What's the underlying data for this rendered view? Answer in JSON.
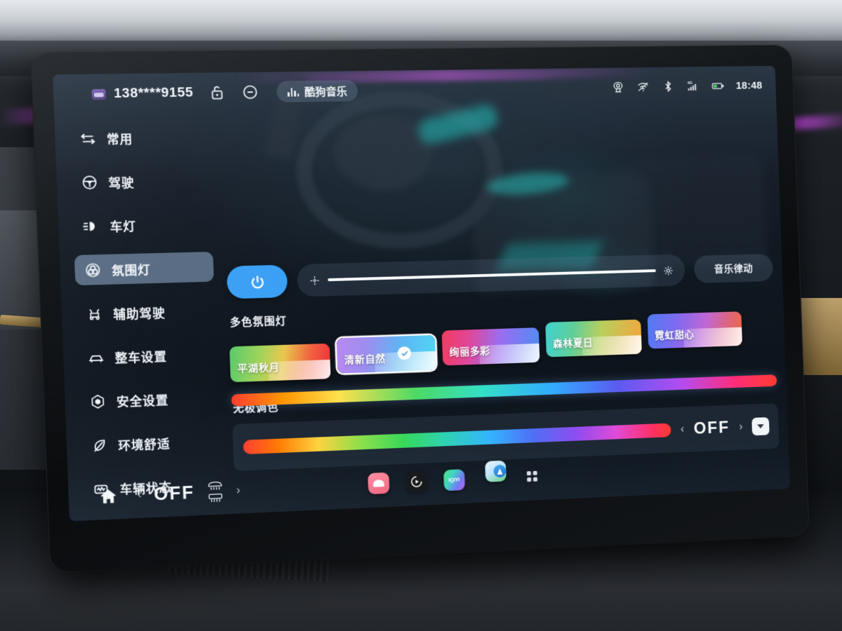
{
  "status_bar": {
    "account_number": "138****9155",
    "lock_icon": "unlock-icon",
    "mute_icon": "minus-circle-icon",
    "music_app_label": "酷狗音乐",
    "music_icon": "equalizer-bars-icon",
    "right_icons": [
      "camera-icon",
      "wifi-off-icon",
      "bluetooth-icon",
      "cellular-4g-icon",
      "battery-icon"
    ],
    "network_label": "4G",
    "time": "18:48"
  },
  "sidebar": {
    "items": [
      {
        "label": "常用",
        "icon": "sliders-icon",
        "selected": false
      },
      {
        "label": "驾驶",
        "icon": "steering-wheel-icon",
        "selected": false
      },
      {
        "label": "车灯",
        "icon": "headlight-icon",
        "selected": false
      },
      {
        "label": "氛围灯",
        "icon": "ambient-light-icon",
        "selected": true
      },
      {
        "label": "辅助驾驶",
        "icon": "adas-icon",
        "selected": false
      },
      {
        "label": "整车设置",
        "icon": "car-icon",
        "selected": false
      },
      {
        "label": "安全设置",
        "icon": "cube-shield-icon",
        "selected": false
      },
      {
        "label": "环境舒适",
        "icon": "leaf-icon",
        "selected": false
      },
      {
        "label": "车辆状态",
        "icon": "vehicle-status-icon",
        "selected": false
      }
    ]
  },
  "main": {
    "power_button": {
      "icon": "power-icon",
      "state": "on",
      "accent_color": "#3aa0f5"
    },
    "brightness": {
      "left_icon": "low-brightness-icon",
      "right_icon": "high-brightness-icon",
      "value_percent": 100
    },
    "music_rhythm_label": "音乐律动",
    "multicolor_section_title": "多色氛围灯",
    "presets": [
      {
        "name": "平湖秋月",
        "gradient": "linear-gradient(100deg,#57c96b 0%,#9bd45c 28%,#e8c84e 52%,#f0613f 78%,#ef2f3c 100%)",
        "selected": false
      },
      {
        "name": "清新自然",
        "gradient": "linear-gradient(100deg,#b989ef 0%,#9d8df0 30%,#5fb5f2 62%,#4fd7f5 100%)",
        "selected": true
      },
      {
        "name": "绚丽多彩",
        "gradient": "linear-gradient(100deg,#f23b5e 0%,#e0479a 28%,#9a6ef0 58%,#4d8cf5 100%)",
        "selected": false
      },
      {
        "name": "森林夏日",
        "gradient": "linear-gradient(100deg,#3fd2d2 0%,#5ecf9a 28%,#b8cf5e 56%,#f5a53a 100%)",
        "selected": false
      },
      {
        "name": "霓虹甜心",
        "gradient": "linear-gradient(100deg,#4f7bf2 0%,#7f6af0 30%,#c067d4 60%,#f2653d 100%)",
        "selected": false
      }
    ],
    "color_wheel_title": "无极调色",
    "wheel_mode_value": "OFF",
    "wheel_prev_icon": "chevron-left-icon",
    "wheel_next_icon": "chevron-right-icon",
    "collapse_icon": "caret-down-icon"
  },
  "bottom_bar": {
    "home_icon": "home-icon",
    "prev_icon": "chevron-left-icon",
    "climate_value": "OFF",
    "defrost_front_icon": "front-defrost-icon",
    "defrost_rear_icon": "rear-defrost-icon",
    "next_icon": "chevron-right-icon",
    "dock_apps": [
      {
        "name": "kugou-music-app",
        "label": ""
      },
      {
        "name": "video-player-app",
        "label": ""
      },
      {
        "name": "iqiyi-app",
        "label": "iQIYI"
      },
      {
        "name": "navigation-app",
        "label": ""
      },
      {
        "name": "all-apps-grid",
        "label": ""
      }
    ]
  }
}
